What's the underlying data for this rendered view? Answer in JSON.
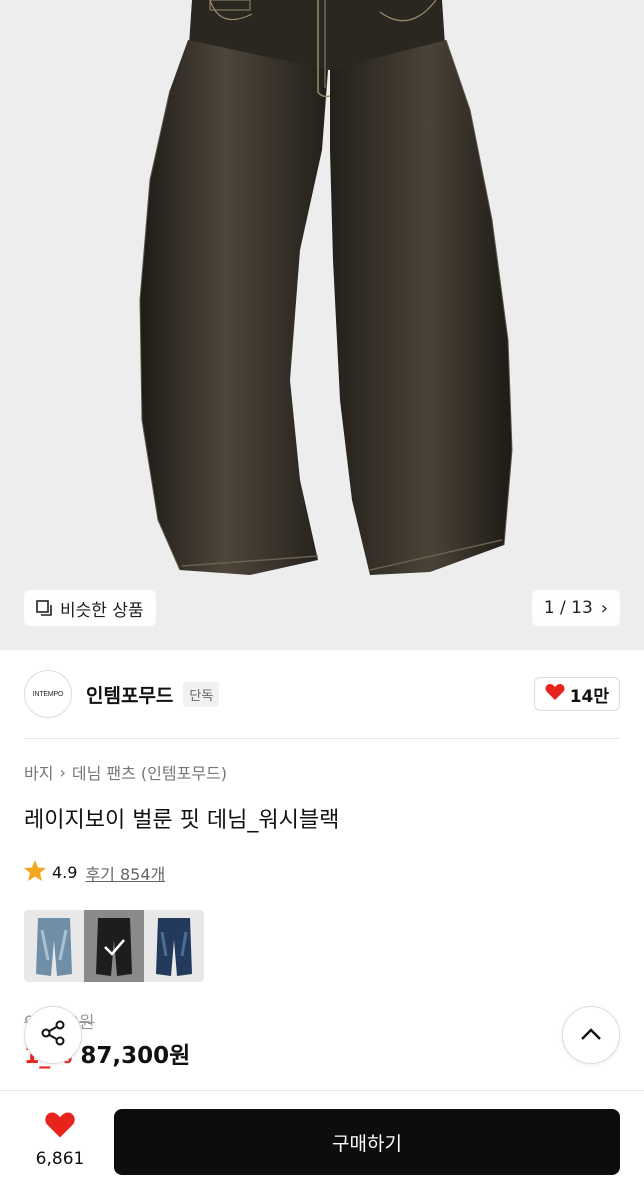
{
  "hero": {
    "similar_label": "비슷한 상품",
    "counter": "1 / 13"
  },
  "brand": {
    "logo_text": "INTEMPO",
    "name": "인템포무드",
    "badge": "단독",
    "likes": "14만"
  },
  "breadcrumb": {
    "category": "바지",
    "subcategory": "데님 팬츠 (인템포무드)"
  },
  "product": {
    "title": "레이지보이 벌룬 핏 데님_워시블랙",
    "rating": "4.9",
    "reviews": "후기 854개",
    "swatches": [
      {
        "name": "light-blue-wash",
        "color": "#6f8fa8"
      },
      {
        "name": "wash-black",
        "color": "#1d1d1d"
      },
      {
        "name": "dark-indigo",
        "color": "#233a5c"
      }
    ],
    "original_price": "9_,_00원",
    "discount": "1_%",
    "price": "87,300원"
  },
  "bottom": {
    "wish_count": "6,861",
    "buy_label": "구매하기"
  },
  "colors": {
    "accent_red": "#e8231e",
    "star": "#f5a623",
    "button_black": "#0d0d0d"
  }
}
